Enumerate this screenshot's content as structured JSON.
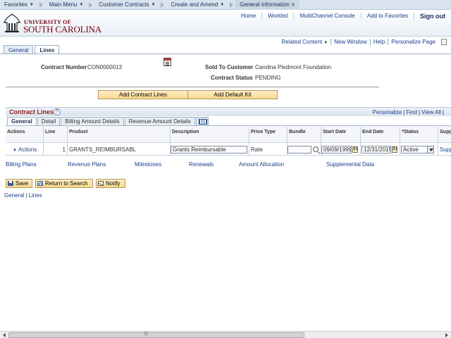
{
  "topnav": {
    "favorites": "Favorites",
    "main_menu": "Main Menu",
    "customer_contracts": "Customer Contracts",
    "create_amend": "Create and Amend",
    "general_information": "General Information"
  },
  "header": {
    "univ_line1": "UNIVERSITY OF",
    "univ_line2": "SOUTH CAROLINA",
    "links": {
      "home": "Home",
      "worklist": "Worklist",
      "multichannel": "MultiChannel Console",
      "add_favorites": "Add to Favorites",
      "sign_out": "Sign out"
    }
  },
  "related": {
    "related_content": "Related Content",
    "new_window": "New Window",
    "help": "Help",
    "personalize_page": "Personalize Page"
  },
  "page_tabs": {
    "general": "General",
    "lines": "Lines"
  },
  "contract": {
    "number_label": "Contract Number",
    "number_value": "CON0000013",
    "sold_to_label": "Sold To Customer",
    "sold_to_value": "Carolina Piedmont Foundation",
    "status_label": "Contract Status",
    "status_value": "PENDING"
  },
  "buttons": {
    "add_contract_lines": "Add Contract Lines",
    "add_default_kit": "Add Default Kit",
    "save": "Save",
    "return_to_search": "Return to Search",
    "notify": "Notify"
  },
  "grid": {
    "title": "Contract Lines",
    "help": "?",
    "personalize": "Personalize",
    "find": "Find",
    "view_all": "View All",
    "tabs": {
      "general": "General",
      "detail": "Detail",
      "billing_amount": "Billing Amount Details",
      "revenue_amount": "Revenue Amount Details"
    },
    "columns": {
      "actions": "Actions",
      "line": "Line",
      "product": "Product",
      "description": "Description",
      "price_type": "Price Type",
      "bundle": "Bundle",
      "start_date": "Start Date",
      "end_date": "End Date",
      "status": "*Status",
      "supp": "Supp"
    },
    "row": {
      "actions": "Actions",
      "line": "1",
      "product": "GRANTS_REIMBURSABL",
      "description": "Grants Reimbursable",
      "price_type": "Rate",
      "bundle": "",
      "start_date": "09/09/1999",
      "end_date": "12/31/2015",
      "status": "Active",
      "supp": "Supp"
    }
  },
  "sublinks": {
    "billing_plans": "Billing Plans",
    "revenue_plans": "Revenue Plans",
    "milestones": "Milestones",
    "renewals": "Renewals",
    "amount_allocation": "Amount Allocation",
    "supplemental_data": "Supplemental Data"
  },
  "bottom": {
    "general": "General",
    "lines": "Lines"
  },
  "colors": {
    "brand": "#73000a",
    "link": "#1a3e8c",
    "button": "#f8d98a"
  }
}
